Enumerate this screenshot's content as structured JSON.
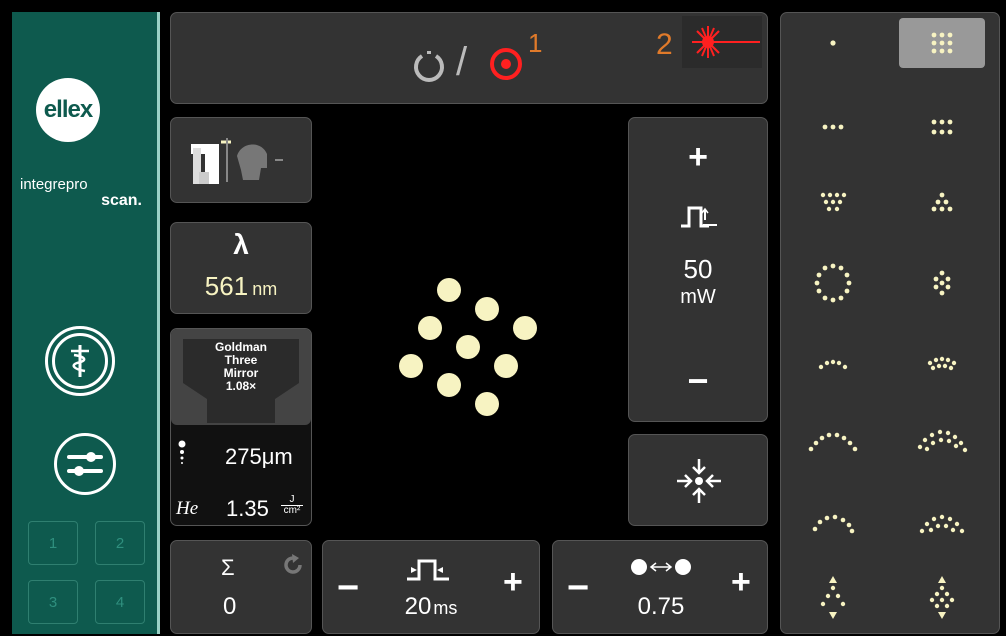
{
  "sidebar": {
    "logo_text": "ellex",
    "brand_line1": "integrepro",
    "brand_line2": "scan.",
    "memory_slots": [
      "1",
      "2",
      "3",
      "4"
    ]
  },
  "topbar": {
    "mode_label_1": "1",
    "mode_label_2": "2",
    "ready_icon": "standby-power-icon",
    "treat_icon": "target-icon",
    "laser_icon": "laser-star-icon"
  },
  "wavelength": {
    "symbol": "λ",
    "value": "561",
    "unit": "nm"
  },
  "lens": {
    "line1": "Goldman",
    "line2": "Three",
    "line3": "Mirror",
    "line4": "1.08×"
  },
  "spot": {
    "size": "275μm",
    "fluence_label": "He",
    "fluence_value": "1.35",
    "fluence_unit_num": "J",
    "fluence_unit_den": "cm²"
  },
  "power": {
    "plus": "+",
    "minus": "−",
    "value": "50",
    "unit": "mW"
  },
  "count": {
    "symbol": "Σ",
    "value": "0"
  },
  "duration": {
    "minus": "−",
    "plus": "+",
    "value": "20",
    "unit": "ms"
  },
  "spacing": {
    "minus": "−",
    "plus": "+",
    "value": "0.75"
  },
  "colors": {
    "sidebar": "#0e5a4e",
    "panel": "#333333",
    "spot": "#f7f3c2",
    "accent_orange": "#e07a2a",
    "laser_red": "#ff2020"
  }
}
